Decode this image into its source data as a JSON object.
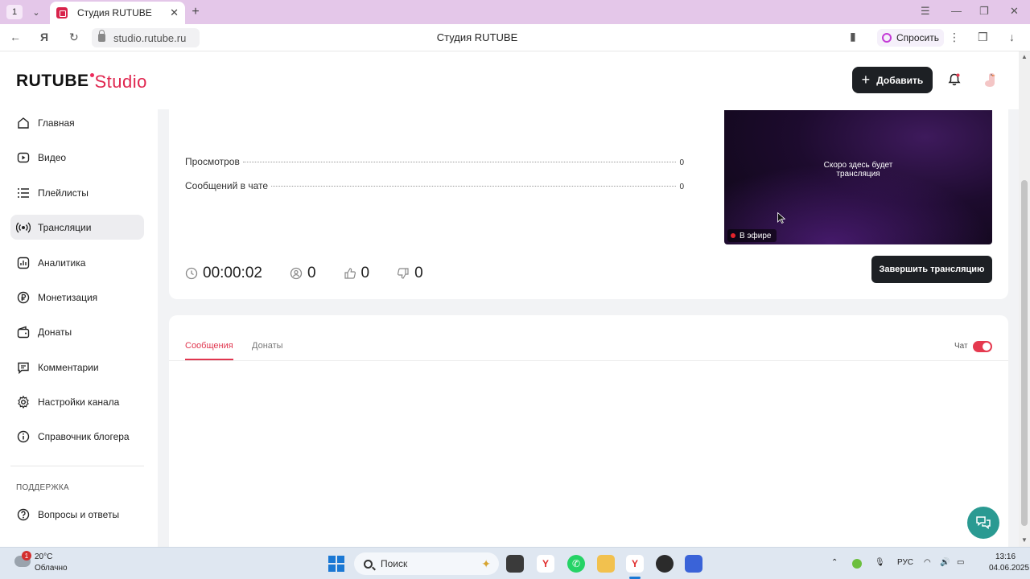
{
  "browser": {
    "tab_count": "1",
    "tab_title": "Студия RUTUBE",
    "url": "studio.rutube.ru",
    "page_title": "Студия RUTUBE",
    "ask_label": "Спросить"
  },
  "header": {
    "logo_main": "RUTUBE",
    "logo_studio": "Studio",
    "add_label": "Добавить",
    "brand_color": "#e0264f"
  },
  "sidebar": {
    "items": [
      {
        "label": "Главная",
        "icon": "home-icon"
      },
      {
        "label": "Видео",
        "icon": "video-icon"
      },
      {
        "label": "Плейлисты",
        "icon": "playlist-icon"
      },
      {
        "label": "Трансляции",
        "icon": "broadcast-icon",
        "active": true
      },
      {
        "label": "Аналитика",
        "icon": "analytics-icon"
      },
      {
        "label": "Монетизация",
        "icon": "ruble-icon"
      },
      {
        "label": "Донаты",
        "icon": "wallet-icon"
      },
      {
        "label": "Комментарии",
        "icon": "comment-icon"
      },
      {
        "label": "Настройки канала",
        "icon": "gear-icon"
      },
      {
        "label": "Справочник блогера",
        "icon": "info-icon"
      }
    ],
    "support_title": "ПОДДЕРЖКА",
    "support_items": [
      {
        "label": "Вопросы и ответы",
        "icon": "question-icon"
      }
    ]
  },
  "stream": {
    "stats": [
      {
        "label": "Просмотров",
        "value": "0"
      },
      {
        "label": "Сообщений в чате",
        "value": "0"
      }
    ],
    "preview_text_line1": "Скоро здесь будет",
    "preview_text_line2": "трансляция",
    "live_label": "В эфире",
    "duration": "00:00:02",
    "viewers": "0",
    "likes": "0",
    "dislikes": "0",
    "end_label": "Завершить трансляцию"
  },
  "chat": {
    "tabs": [
      {
        "label": "Сообщения",
        "active": true
      },
      {
        "label": "Донаты",
        "active": false
      }
    ],
    "toggle_label": "Чат",
    "toggle_on": true
  },
  "taskbar": {
    "notification_count": "1",
    "temperature": "20°C",
    "weather": "Облачно",
    "search_placeholder": "Поиск",
    "language": "РУС",
    "time": "13:16",
    "date": "04.06.2025"
  }
}
